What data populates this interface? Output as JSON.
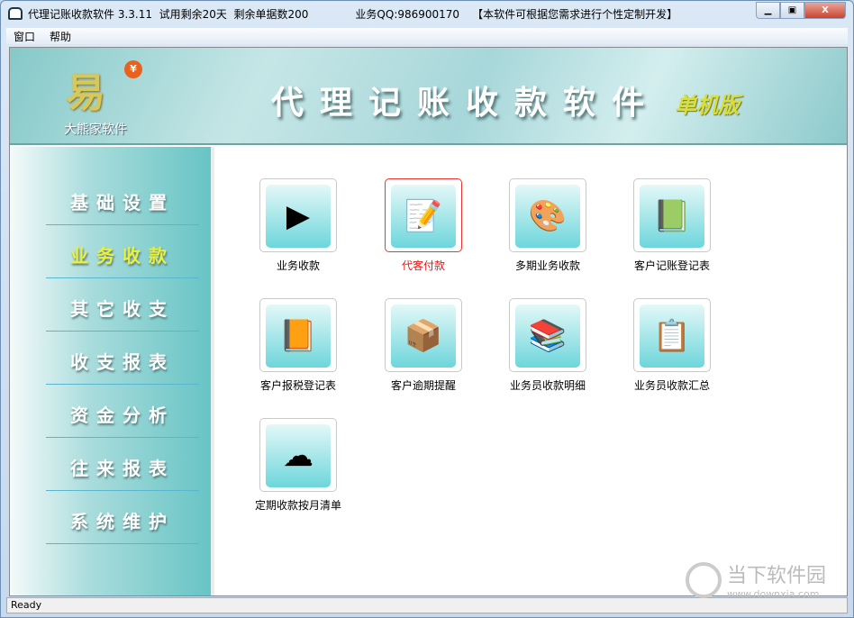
{
  "titlebar": {
    "title": "代理记账收款软件 3.3.11  试用剩余20天  剩余单据数200",
    "qq": "业务QQ:986900170",
    "notice": "【本软件可根据您需求进行个性定制开发】"
  },
  "menu": [
    "窗口",
    "帮助"
  ],
  "banner": {
    "logo_char": "易",
    "yen": "¥",
    "brand": "大熊家软件",
    "title": "代理记账收款软件",
    "edition": "单机版"
  },
  "sidebar": {
    "items": [
      "基础设置",
      "业务收款",
      "其它收支",
      "收支报表",
      "资金分析",
      "往来报表",
      "系统维护"
    ],
    "active": 1
  },
  "tiles": [
    {
      "label": "业务收款",
      "icon": "▶"
    },
    {
      "label": "代客付款",
      "icon": "📝",
      "selected": true
    },
    {
      "label": "多期业务收款",
      "icon": "🎨"
    },
    {
      "label": "客户记账登记表",
      "icon": "📗"
    },
    {
      "label": "客户报税登记表",
      "icon": "📙"
    },
    {
      "label": "客户逾期提醒",
      "icon": "📦"
    },
    {
      "label": "业务员收款明细",
      "icon": "📚"
    },
    {
      "label": "业务员收款汇总",
      "icon": "📋"
    },
    {
      "label": "定期收款按月清单",
      "icon": "☁"
    }
  ],
  "status": "Ready",
  "watermark": {
    "name": "当下软件园",
    "url": "www.downxia.com"
  }
}
